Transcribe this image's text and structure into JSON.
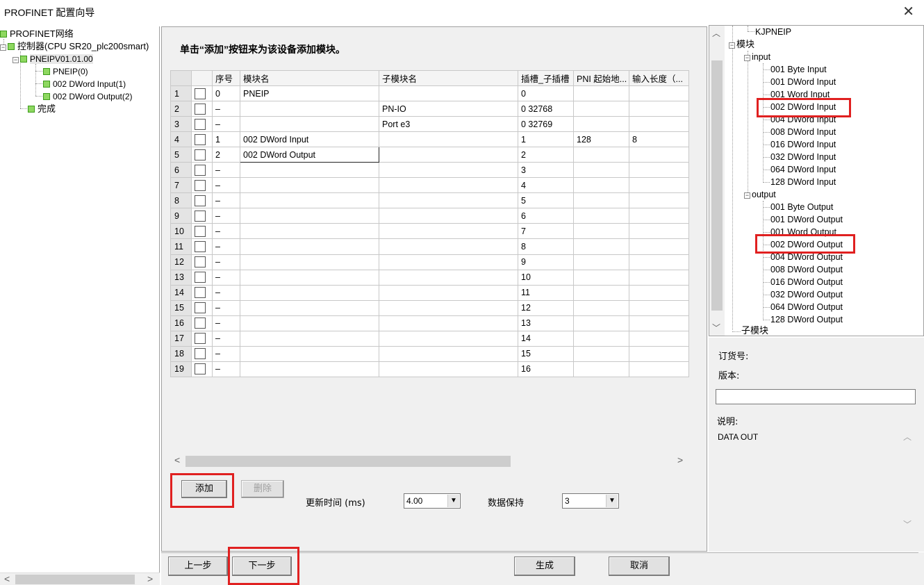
{
  "window": {
    "title": "PROFINET 配置向导",
    "close_glyph": "✕"
  },
  "left_tree": {
    "root": "PROFINET网络",
    "controller": "控制器(CPU SR20_plc200smart)",
    "device": "PNEIPV01.01.00",
    "items": [
      "PNEIP(0)",
      "002 DWord Input(1)",
      "002 DWord Output(2)"
    ],
    "finish": "完成"
  },
  "instruction": "单击“添加”按钮来为该设备添加模块。",
  "grid": {
    "headers": [
      "",
      "",
      "序号",
      "模块名",
      "子模块名",
      "插槽_子插槽",
      "PNI 起始地...",
      "输入长度（..."
    ],
    "rows": [
      {
        "n": "1",
        "seq": "0",
        "module": "PNEIP",
        "sub": "",
        "slot": "0",
        "addr": "",
        "len": ""
      },
      {
        "n": "2",
        "seq": "–",
        "module": "",
        "sub": "PN-IO",
        "slot": "0 32768",
        "addr": "",
        "len": ""
      },
      {
        "n": "3",
        "seq": "–",
        "module": "",
        "sub": "Port e3",
        "slot": "0 32769",
        "addr": "",
        "len": ""
      },
      {
        "n": "4",
        "seq": "1",
        "module": "002 DWord Input",
        "sub": "",
        "slot": "1",
        "addr": "128",
        "len": "8"
      },
      {
        "n": "5",
        "seq": "2",
        "module": "002 DWord Output",
        "sub": "",
        "slot": "2",
        "addr": "",
        "len": ""
      },
      {
        "n": "6",
        "seq": "–",
        "module": "",
        "sub": "",
        "slot": "3",
        "addr": "",
        "len": ""
      },
      {
        "n": "7",
        "seq": "–",
        "module": "",
        "sub": "",
        "slot": "4",
        "addr": "",
        "len": ""
      },
      {
        "n": "8",
        "seq": "–",
        "module": "",
        "sub": "",
        "slot": "5",
        "addr": "",
        "len": ""
      },
      {
        "n": "9",
        "seq": "–",
        "module": "",
        "sub": "",
        "slot": "6",
        "addr": "",
        "len": ""
      },
      {
        "n": "10",
        "seq": "–",
        "module": "",
        "sub": "",
        "slot": "7",
        "addr": "",
        "len": ""
      },
      {
        "n": "11",
        "seq": "–",
        "module": "",
        "sub": "",
        "slot": "8",
        "addr": "",
        "len": ""
      },
      {
        "n": "12",
        "seq": "–",
        "module": "",
        "sub": "",
        "slot": "9",
        "addr": "",
        "len": ""
      },
      {
        "n": "13",
        "seq": "–",
        "module": "",
        "sub": "",
        "slot": "10",
        "addr": "",
        "len": ""
      },
      {
        "n": "14",
        "seq": "–",
        "module": "",
        "sub": "",
        "slot": "11",
        "addr": "",
        "len": ""
      },
      {
        "n": "15",
        "seq": "–",
        "module": "",
        "sub": "",
        "slot": "12",
        "addr": "",
        "len": ""
      },
      {
        "n": "16",
        "seq": "–",
        "module": "",
        "sub": "",
        "slot": "13",
        "addr": "",
        "len": ""
      },
      {
        "n": "17",
        "seq": "–",
        "module": "",
        "sub": "",
        "slot": "14",
        "addr": "",
        "len": ""
      },
      {
        "n": "18",
        "seq": "–",
        "module": "",
        "sub": "",
        "slot": "15",
        "addr": "",
        "len": ""
      },
      {
        "n": "19",
        "seq": "–",
        "module": "",
        "sub": "",
        "slot": "16",
        "addr": "",
        "len": ""
      }
    ]
  },
  "controls": {
    "add_label": "添加",
    "delete_label": "删除",
    "update_time_label": "更新时间 (ms)",
    "update_time_value": "4.00",
    "data_hold_label": "数据保持",
    "data_hold_value": "3"
  },
  "footer": {
    "prev_label": "上一步",
    "next_label": "下一步",
    "generate_label": "生成",
    "cancel_label": "取消"
  },
  "right_tree": {
    "top_item": "KJPNEIP",
    "modules_label": "模块",
    "input_group": "input",
    "inputs": [
      "001 Byte Input",
      "001 DWord Input",
      "001 Word Input",
      "002 DWord Input",
      "004 DWord Input",
      "008 DWord Input",
      "016 DWord Input",
      "032 DWord Input",
      "064 DWord Input",
      "128 DWord Input"
    ],
    "output_group": "output",
    "outputs": [
      "001 Byte Output",
      "001 DWord Output",
      "001 Word Output",
      "002 DWord Output",
      "004 DWord Output",
      "008 DWord Output",
      "016 DWord Output",
      "032 DWord Output",
      "064 DWord Output",
      "128 DWord Output"
    ],
    "submodules_label": "子模块"
  },
  "info": {
    "order_label": "订货号:",
    "version_label": "版本:",
    "desc_label": "说明:",
    "desc_text": "DATA OUT"
  },
  "colors": {
    "highlight_box": "#e02020",
    "tree_node": "#8ed860"
  }
}
